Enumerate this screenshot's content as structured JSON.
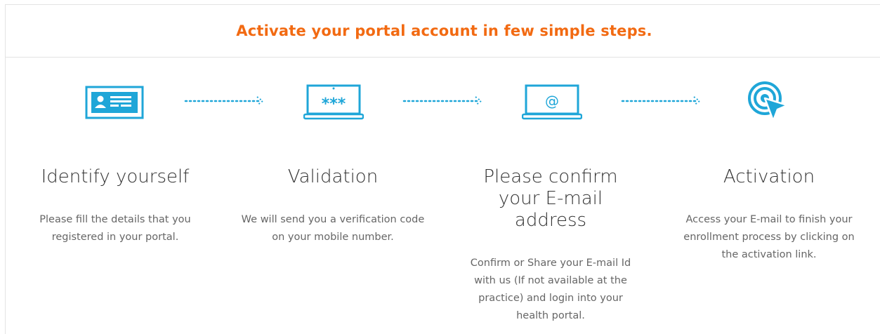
{
  "header": {
    "title": "Activate your portal account in few simple steps."
  },
  "colors": {
    "accent": "#f26a12",
    "icon": "#1fa6d8"
  },
  "steps": [
    {
      "icon": "id-card-icon",
      "title": "Identify yourself",
      "description": "Please fill the details that you registered in your portal."
    },
    {
      "icon": "laptop-password-icon",
      "icon_text": "***",
      "title": "Validation",
      "description": "We will send you a verification code on your mobile number."
    },
    {
      "icon": "laptop-email-icon",
      "icon_text": "@",
      "title": "Please confirm your E-mail address",
      "description": "Confirm or Share your E-mail Id with us (If not available at the practice) and login into your health portal."
    },
    {
      "icon": "click-target-icon",
      "title": "Activation",
      "description": "Access your E-mail to finish your enrollment process by clicking on the activation link."
    }
  ]
}
